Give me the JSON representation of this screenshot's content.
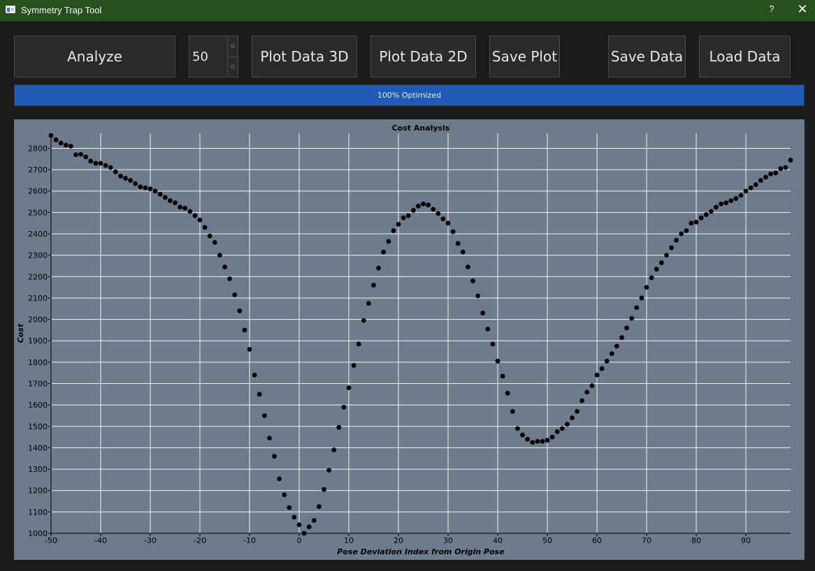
{
  "window": {
    "title": "Symmetry Trap Tool",
    "help_label": "?",
    "close_label": "✕",
    "icon": "app-window-icon"
  },
  "toolbar": {
    "analyze_label": "Analyze",
    "iterations_value": "50",
    "spin_up_icon": "spin-up-arrow",
    "spin_down_icon": "spin-down-arrow",
    "plot3d_label": "Plot Data 3D",
    "plot2d_label": "Plot Data 2D",
    "save_plot_label": "Save Plot",
    "save_data_label": "Save Data",
    "load_data_label": "Load Data"
  },
  "progress": {
    "value_percent": 100,
    "text": "100% Optimized",
    "color": "#1f5bb5"
  },
  "colors": {
    "titlebar": "#284f1e",
    "window_bg": "#1b1b1b",
    "plot_bg": "#6e7b8b",
    "grid": "#ffffff",
    "marker": "#000000"
  },
  "chart_data": {
    "type": "scatter",
    "title": "Cost Analysis",
    "xlabel": "Pose Deviation Index from Origin Pose",
    "ylabel": "Cost",
    "xlim": [
      -50,
      99
    ],
    "ylim": [
      1000,
      2870
    ],
    "xticks": [
      -50,
      -40,
      -30,
      -20,
      -10,
      0,
      10,
      20,
      30,
      40,
      50,
      60,
      70,
      80,
      90
    ],
    "yticks": [
      1000,
      1100,
      1200,
      1300,
      1400,
      1500,
      1600,
      1700,
      1800,
      1900,
      2000,
      2100,
      2200,
      2300,
      2400,
      2500,
      2600,
      2700,
      2800
    ],
    "grid": true,
    "x": [
      -50,
      -49,
      -48,
      -47,
      -46,
      -45,
      -44,
      -43,
      -42,
      -41,
      -40,
      -39,
      -38,
      -37,
      -36,
      -35,
      -34,
      -33,
      -32,
      -31,
      -30,
      -29,
      -28,
      -27,
      -26,
      -25,
      -24,
      -23,
      -22,
      -21,
      -20,
      -19,
      -18,
      -17,
      -16,
      -15,
      -14,
      -13,
      -12,
      -11,
      -10,
      -9,
      -8,
      -7,
      -6,
      -5,
      -4,
      -3,
      -2,
      -1,
      0,
      1,
      2,
      3,
      4,
      5,
      6,
      7,
      8,
      9,
      10,
      11,
      12,
      13,
      14,
      15,
      16,
      17,
      18,
      19,
      20,
      21,
      22,
      23,
      24,
      25,
      26,
      27,
      28,
      29,
      30,
      31,
      32,
      33,
      34,
      35,
      36,
      37,
      38,
      39,
      40,
      41,
      42,
      43,
      44,
      45,
      46,
      47,
      48,
      49,
      50,
      51,
      52,
      53,
      54,
      55,
      56,
      57,
      58,
      59,
      60,
      61,
      62,
      63,
      64,
      65,
      66,
      67,
      68,
      69,
      70,
      71,
      72,
      73,
      74,
      75,
      76,
      77,
      78,
      79,
      80,
      81,
      82,
      83,
      84,
      85,
      86,
      87,
      88,
      89,
      90,
      91,
      92,
      93,
      94,
      95,
      96,
      97,
      98,
      99
    ],
    "y": [
      2860,
      2840,
      2825,
      2815,
      2810,
      2770,
      2772,
      2760,
      2740,
      2730,
      2730,
      2720,
      2710,
      2690,
      2670,
      2660,
      2650,
      2635,
      2620,
      2615,
      2610,
      2600,
      2585,
      2570,
      2555,
      2545,
      2525,
      2520,
      2505,
      2485,
      2465,
      2430,
      2390,
      2360,
      2300,
      2245,
      2190,
      2115,
      2040,
      1950,
      1860,
      1740,
      1650,
      1550,
      1445,
      1360,
      1255,
      1180,
      1120,
      1075,
      1040,
      1000,
      1030,
      1060,
      1125,
      1205,
      1295,
      1390,
      1495,
      1590,
      1680,
      1785,
      1885,
      1995,
      2075,
      2160,
      2240,
      2315,
      2365,
      2415,
      2445,
      2475,
      2485,
      2510,
      2530,
      2540,
      2535,
      2515,
      2495,
      2470,
      2450,
      2410,
      2355,
      2315,
      2245,
      2180,
      2110,
      2030,
      1955,
      1885,
      1805,
      1735,
      1655,
      1570,
      1490,
      1460,
      1440,
      1425,
      1430,
      1430,
      1435,
      1450,
      1475,
      1490,
      1510,
      1540,
      1570,
      1620,
      1660,
      1690,
      1740,
      1770,
      1805,
      1840,
      1875,
      1915,
      1960,
      2005,
      2055,
      2100,
      2150,
      2195,
      2235,
      2265,
      2300,
      2335,
      2370,
      2400,
      2415,
      2450,
      2455,
      2475,
      2490,
      2505,
      2525,
      2540,
      2545,
      2555,
      2565,
      2580,
      2600,
      2615,
      2630,
      2650,
      2665,
      2680,
      2685,
      2705,
      2710,
      2745,
      2760,
      2775
    ]
  }
}
